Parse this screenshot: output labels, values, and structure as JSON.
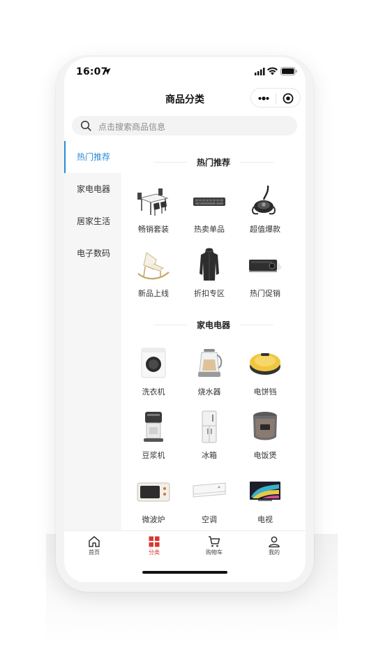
{
  "status_bar": {
    "time": "16:07"
  },
  "nav": {
    "title": "商品分类"
  },
  "search": {
    "placeholder": "点击搜索商品信息"
  },
  "sidebar": {
    "items": [
      {
        "label": "热门推荐",
        "active": true
      },
      {
        "label": "家电电器",
        "active": false
      },
      {
        "label": "居家生活",
        "active": false
      },
      {
        "label": "电子数码",
        "active": false
      }
    ]
  },
  "sections": [
    {
      "title": "热门推荐",
      "items": [
        {
          "label": "畅销套装",
          "icon": "dining-set-icon"
        },
        {
          "label": "热卖单品",
          "icon": "keyboard-icon"
        },
        {
          "label": "超值爆款",
          "icon": "car-phone-holder-icon"
        },
        {
          "label": "新品上线",
          "icon": "rocking-chair-icon"
        },
        {
          "label": "折扣专区",
          "icon": "jacket-icon"
        },
        {
          "label": "热门促销",
          "icon": "projector-icon"
        }
      ]
    },
    {
      "title": "家电电器",
      "items": [
        {
          "label": "洗衣机",
          "icon": "washing-machine-icon"
        },
        {
          "label": "烧水器",
          "icon": "kettle-icon"
        },
        {
          "label": "电饼铛",
          "icon": "electric-pan-icon"
        },
        {
          "label": "豆浆机",
          "icon": "soymilk-maker-icon"
        },
        {
          "label": "冰箱",
          "icon": "fridge-icon"
        },
        {
          "label": "电饭煲",
          "icon": "rice-cooker-icon"
        },
        {
          "label": "微波炉",
          "icon": "microwave-icon"
        },
        {
          "label": "空调",
          "icon": "air-conditioner-icon"
        },
        {
          "label": "电视",
          "icon": "tv-icon"
        }
      ]
    }
  ],
  "tabbar": {
    "items": [
      {
        "label": "首页",
        "icon": "home-icon",
        "active": false
      },
      {
        "label": "分类",
        "icon": "category-icon",
        "active": true
      },
      {
        "label": "购物车",
        "icon": "cart-icon",
        "active": false
      },
      {
        "label": "我的",
        "icon": "user-icon",
        "active": false
      }
    ]
  },
  "colors": {
    "accent": "#2b8cd6",
    "tab_active": "#d9382e"
  }
}
